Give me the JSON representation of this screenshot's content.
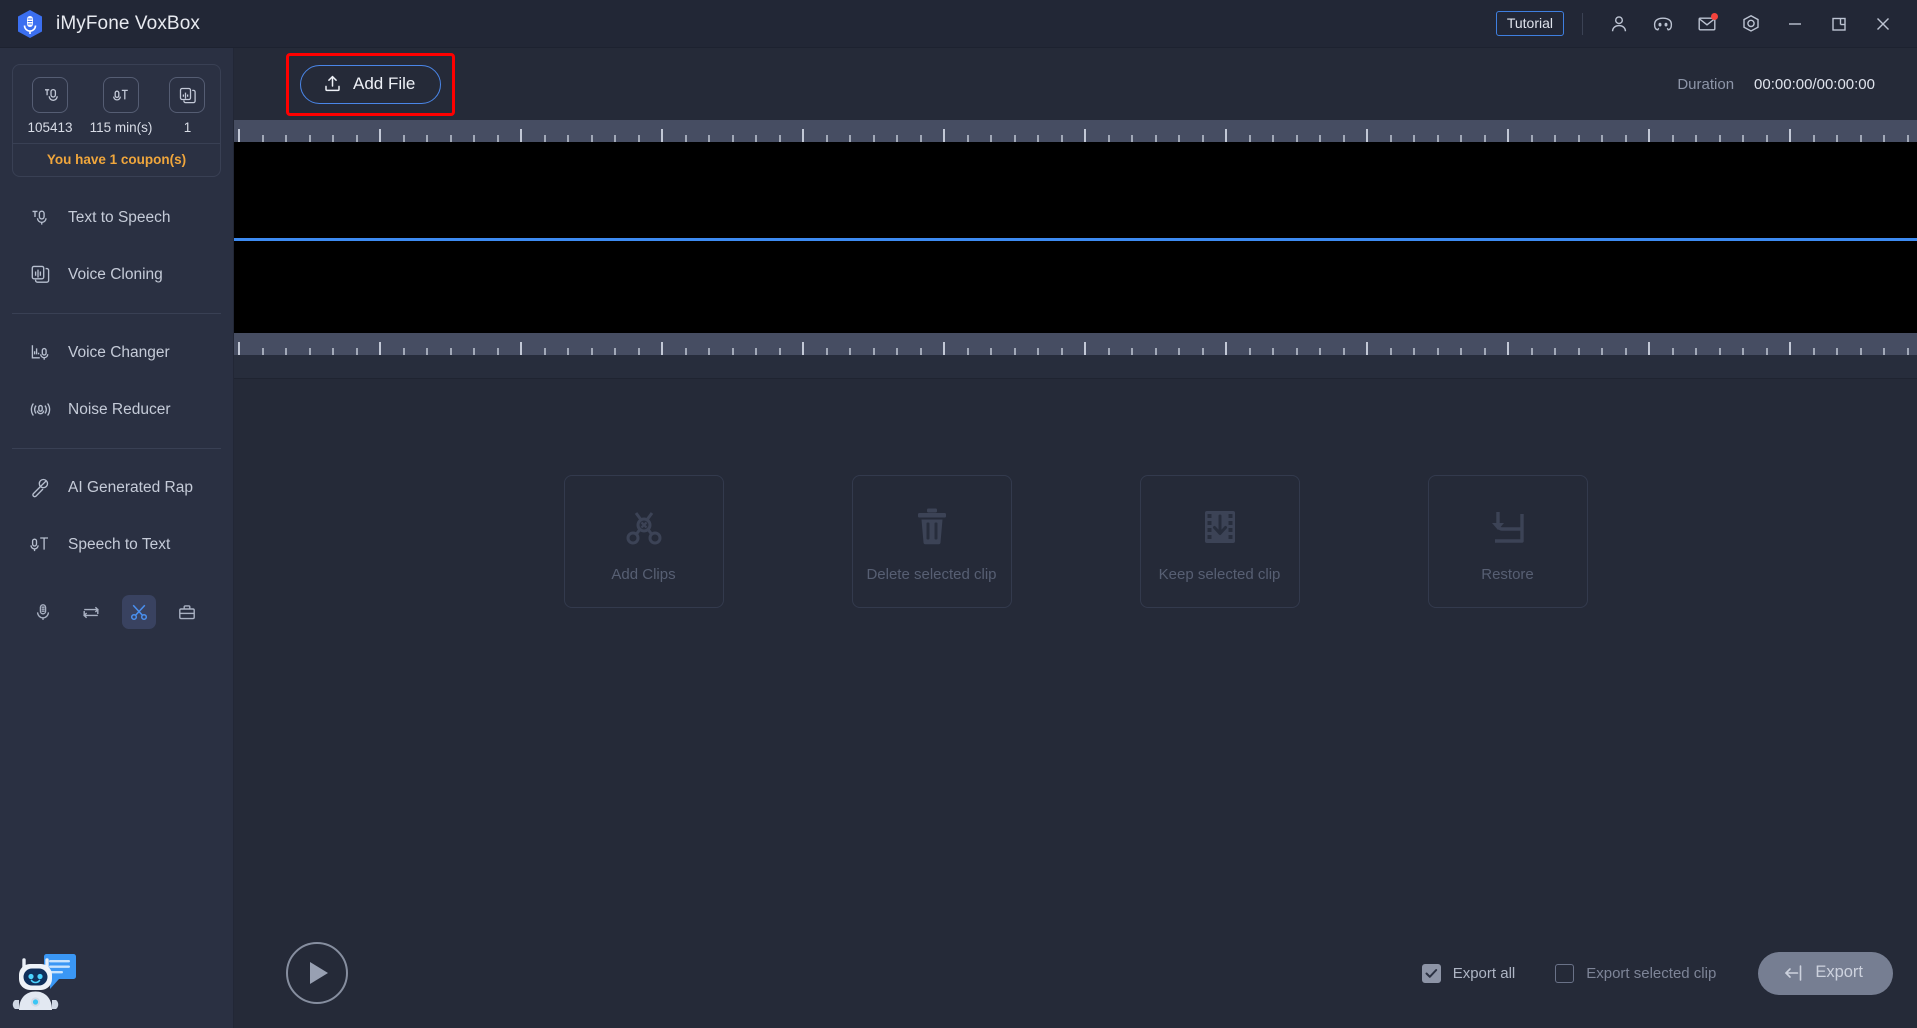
{
  "titlebar": {
    "app_title": "iMyFone VoxBox",
    "logo_icon": "microphone-hex-logo",
    "tutorial_label": "Tutorial",
    "icons": [
      {
        "name": "account-icon",
        "glyph": "person"
      },
      {
        "name": "discord-icon",
        "glyph": "discord"
      },
      {
        "name": "mail-icon",
        "glyph": "envelope",
        "badge": true
      },
      {
        "name": "settings-icon",
        "glyph": "gear-hex"
      },
      {
        "name": "minimize-icon",
        "glyph": "minus"
      },
      {
        "name": "maximize-icon",
        "glyph": "restore"
      },
      {
        "name": "close-icon",
        "glyph": "x"
      }
    ],
    "badge_color": "#f5433c",
    "tutorial_border_color": "#3f7fe0"
  },
  "sidebar": {
    "credits": {
      "items": [
        {
          "icon": "text-to-speech-icon",
          "value": "105413"
        },
        {
          "icon": "speech-to-text-icon",
          "value": "115 min(s)"
        },
        {
          "icon": "voice-cloning-icon",
          "value": "1"
        }
      ],
      "coupon_text": "You have 1 coupon(s)",
      "coupon_color": "#f0a63c"
    },
    "nav": [
      {
        "label": "Text to Speech",
        "icon": "text-to-speech-icon"
      },
      {
        "label": "Voice Cloning",
        "icon": "voice-cloning-icon"
      },
      {
        "label": "Voice Changer",
        "icon": "voice-changer-icon"
      },
      {
        "label": "Noise Reducer",
        "icon": "noise-reducer-icon"
      },
      {
        "label": "AI Generated Rap",
        "icon": "ai-rap-icon"
      },
      {
        "label": "Speech to Text",
        "icon": "speech-to-text-icon"
      }
    ],
    "tools": [
      {
        "name": "recorder-icon",
        "active": false
      },
      {
        "name": "converter-icon",
        "active": false
      },
      {
        "name": "cutter-icon",
        "active": true
      },
      {
        "name": "toolbox-icon",
        "active": false
      }
    ],
    "active_tool_color": "#4a90f0",
    "assistant_icon": "chatbot-assistant-icon"
  },
  "toolbar": {
    "add_file_label": "Add File",
    "add_file_icon": "upload-icon",
    "highlight_color": "#ff0000",
    "duration_label": "Duration",
    "duration_value": "00:00:00/00:00:00"
  },
  "timeline": {
    "playhead_color": "#3d8bf2",
    "ruler_bg": "#464d62",
    "track_bg": "#000000"
  },
  "clip_actions": [
    {
      "label": "Add Clips",
      "icon": "scissors-add-icon",
      "enabled": false
    },
    {
      "label": "Delete selected clip",
      "icon": "trash-icon",
      "enabled": false
    },
    {
      "label": "Keep selected clip",
      "icon": "filmstrip-down-icon",
      "enabled": false
    },
    {
      "label": "Restore",
      "icon": "restore-arrow-icon",
      "enabled": false
    }
  ],
  "footer": {
    "play_icon": "play-icon",
    "export_all_label": "Export all",
    "export_all_checked": true,
    "export_selected_label": "Export selected clip",
    "export_selected_checked": false,
    "export_button_label": "Export",
    "export_button_icon": "export-arrow-icon"
  }
}
